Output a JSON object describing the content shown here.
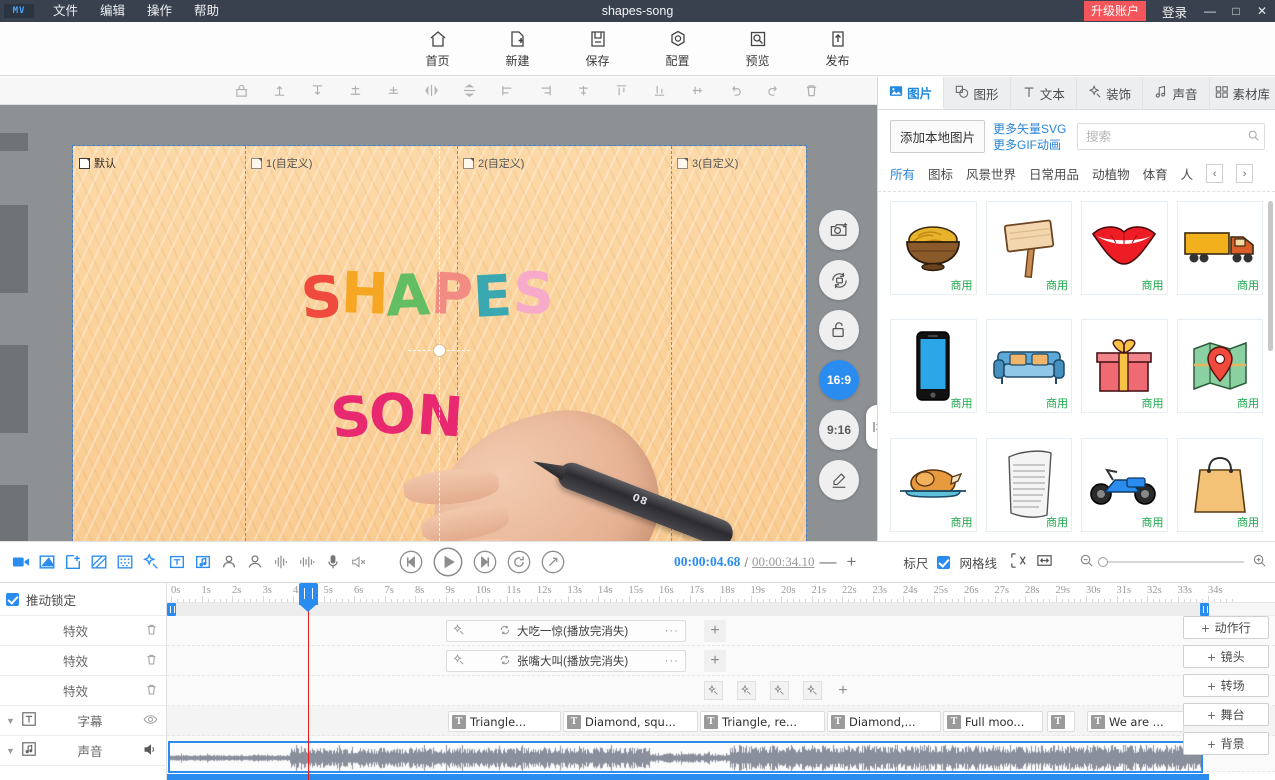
{
  "titlebar": {
    "logo": "MV",
    "menus": [
      "文件",
      "编辑",
      "操作",
      "帮助"
    ],
    "project_title": "shapes-song",
    "upgrade": "升级账户",
    "login": "登录",
    "minimize": "—",
    "maximize": "□",
    "close": "✕"
  },
  "toolbar": {
    "buttons": [
      {
        "label": "首页",
        "icon": "home-icon"
      },
      {
        "label": "新建",
        "icon": "new-file-icon"
      },
      {
        "label": "保存",
        "icon": "save-icon"
      },
      {
        "label": "配置",
        "icon": "settings-icon"
      },
      {
        "label": "预览",
        "icon": "preview-icon"
      },
      {
        "label": "发布",
        "icon": "publish-icon"
      }
    ]
  },
  "canvas": {
    "scenes": [
      {
        "label": "默认"
      },
      {
        "label": "1(自定义)"
      },
      {
        "label": "2(自定义)"
      },
      {
        "label": "3(自定义)"
      }
    ],
    "title_line1": "SHAPES",
    "title_line2": "SON",
    "pen_label": "08",
    "side_tools": [
      {
        "name": "snapshot-icon",
        "label": ""
      },
      {
        "name": "replace-icon",
        "label": ""
      },
      {
        "name": "unlock-icon",
        "label": ""
      },
      {
        "name": "ratio-16-9",
        "label": "16:9",
        "active": true
      },
      {
        "name": "ratio-9-16",
        "label": "9:16",
        "active": false
      },
      {
        "name": "edit-pen-icon",
        "label": ""
      }
    ],
    "align_tools": [
      "lock",
      "align-top",
      "align-bottom",
      "align-middle-v",
      "align-center-v",
      "flip-horizontal",
      "flip-vertical",
      "align-left",
      "align-right",
      "align-center-h",
      "distribute-top",
      "distribute-bottom",
      "distribute-middle",
      "undo",
      "redo",
      "delete"
    ]
  },
  "library": {
    "tabs": [
      {
        "label": "图片",
        "icon": "image-icon",
        "active": true
      },
      {
        "label": "图形",
        "icon": "shape-icon",
        "active": false
      },
      {
        "label": "文本",
        "icon": "text-icon",
        "active": false
      },
      {
        "label": "装饰",
        "icon": "decoration-icon",
        "active": false
      },
      {
        "label": "声音",
        "icon": "sound-icon",
        "active": false
      },
      {
        "label": "素材库",
        "icon": "asset-library-icon",
        "active": false
      }
    ],
    "add_local": "添加本地图片",
    "more_svg": "更多矢量SVG",
    "more_gif": "更多GIF动画",
    "search_placeholder": "搜索",
    "search_value": "",
    "prev_arrow": "‹",
    "next_arrow": "›",
    "categories": [
      {
        "label": "所有",
        "active": true
      },
      {
        "label": "图标",
        "active": false
      },
      {
        "label": "风景世界",
        "active": false
      },
      {
        "label": "日常用品",
        "active": false
      },
      {
        "label": "动植物",
        "active": false
      },
      {
        "label": "体育",
        "active": false
      },
      {
        "label": "人",
        "active": false
      }
    ],
    "commercial_tag": "商用",
    "assets": [
      {
        "name": "noodle-bowl",
        "tag": "商用"
      },
      {
        "name": "wooden-sign",
        "tag": "商用"
      },
      {
        "name": "red-lips",
        "tag": "商用"
      },
      {
        "name": "yellow-truck",
        "tag": "商用"
      },
      {
        "name": "smartphone",
        "tag": "商用"
      },
      {
        "name": "sofa",
        "tag": "商用"
      },
      {
        "name": "gift-box",
        "tag": "商用"
      },
      {
        "name": "map-pin",
        "tag": "商用"
      },
      {
        "name": "roast-chicken",
        "tag": "商用"
      },
      {
        "name": "paper-scroll",
        "tag": "商用"
      },
      {
        "name": "motorcycle",
        "tag": "商用"
      },
      {
        "name": "shopping-bag",
        "tag": "商用"
      }
    ]
  },
  "transport": {
    "left_tools": [
      "video-icon",
      "image-tool-icon",
      "add-frame-icon",
      "mask-icon",
      "halftone-icon",
      "magic-wand-icon",
      "text-tool-icon",
      "music-tool-icon",
      "person-icon",
      "avatar-icon",
      "equalizer-icon",
      "waveform-icon",
      "mic-icon",
      "mute-icon"
    ],
    "playback": [
      "skip-start-icon",
      "play-icon",
      "skip-end-icon",
      "loop-icon",
      "fullscreen-icon"
    ],
    "current_time": "00:00:04.68",
    "separator": "/",
    "total_time": "00:00:34.10",
    "zoom_out": "—",
    "zoom_in": "+",
    "ruler_label": "标尺",
    "grid_label": "网格线",
    "grid_checked": true,
    "fit_icon": "fit-selection-icon",
    "fit_width_icon": "fit-width-icon",
    "zoom_minus_icon": "zoom-out-icon",
    "zoom_plus_icon": "zoom-in-icon"
  },
  "timeline": {
    "lock_label": "推动锁定",
    "lock_checked": true,
    "tracks": [
      {
        "label": "特效",
        "action": "delete-icon"
      },
      {
        "label": "特效",
        "action": "delete-icon"
      },
      {
        "label": "特效",
        "action": "delete-icon"
      },
      {
        "label": "字幕",
        "action": "eye-icon",
        "icon": "text-track-icon",
        "expandable": true
      },
      {
        "label": "声音",
        "action": "volume-icon",
        "icon": "audio-track-icon",
        "expandable": true
      }
    ],
    "ruler_ticks": [
      "0s",
      "1s",
      "2s",
      "3s",
      "4s",
      "5s",
      "6s",
      "7s",
      "8s",
      "9s",
      "10s",
      "11s",
      "12s",
      "13s",
      "14s",
      "15s",
      "16s",
      "17s",
      "18s",
      "19s",
      "20s",
      "21s",
      "22s",
      "23s",
      "24s",
      "25s",
      "26s",
      "27s",
      "28s",
      "29s",
      "30s",
      "31s",
      "32s",
      "33s",
      "34s"
    ],
    "effect_clips": [
      {
        "label": "大吃一惊(播放完消失)",
        "menu": "···",
        "icon": "magic-wand-icon",
        "loop": "loop-icon"
      },
      {
        "label": "张嘴大叫(播放完消失)",
        "menu": "···",
        "icon": "magic-wand-icon",
        "loop": "loop-icon"
      }
    ],
    "add_plus": "+",
    "text_clips": [
      {
        "label": "Triangle...",
        "badge": "T"
      },
      {
        "label": "Diamond, squ...",
        "badge": "T"
      },
      {
        "label": "Triangle, re...",
        "badge": "T"
      },
      {
        "label": "Diamond,...",
        "badge": "T"
      },
      {
        "label": "Full moo...",
        "badge": "T"
      },
      {
        "label": "",
        "badge": "T"
      },
      {
        "label": "We are ...",
        "badge": "T"
      }
    ],
    "add_track_buttons": [
      {
        "label": "动作行",
        "plus": "+"
      },
      {
        "label": "镜头",
        "plus": "+"
      },
      {
        "label": "转场",
        "plus": "+"
      },
      {
        "label": "舞台",
        "plus": "+"
      },
      {
        "label": "背景",
        "plus": "+"
      }
    ]
  }
}
